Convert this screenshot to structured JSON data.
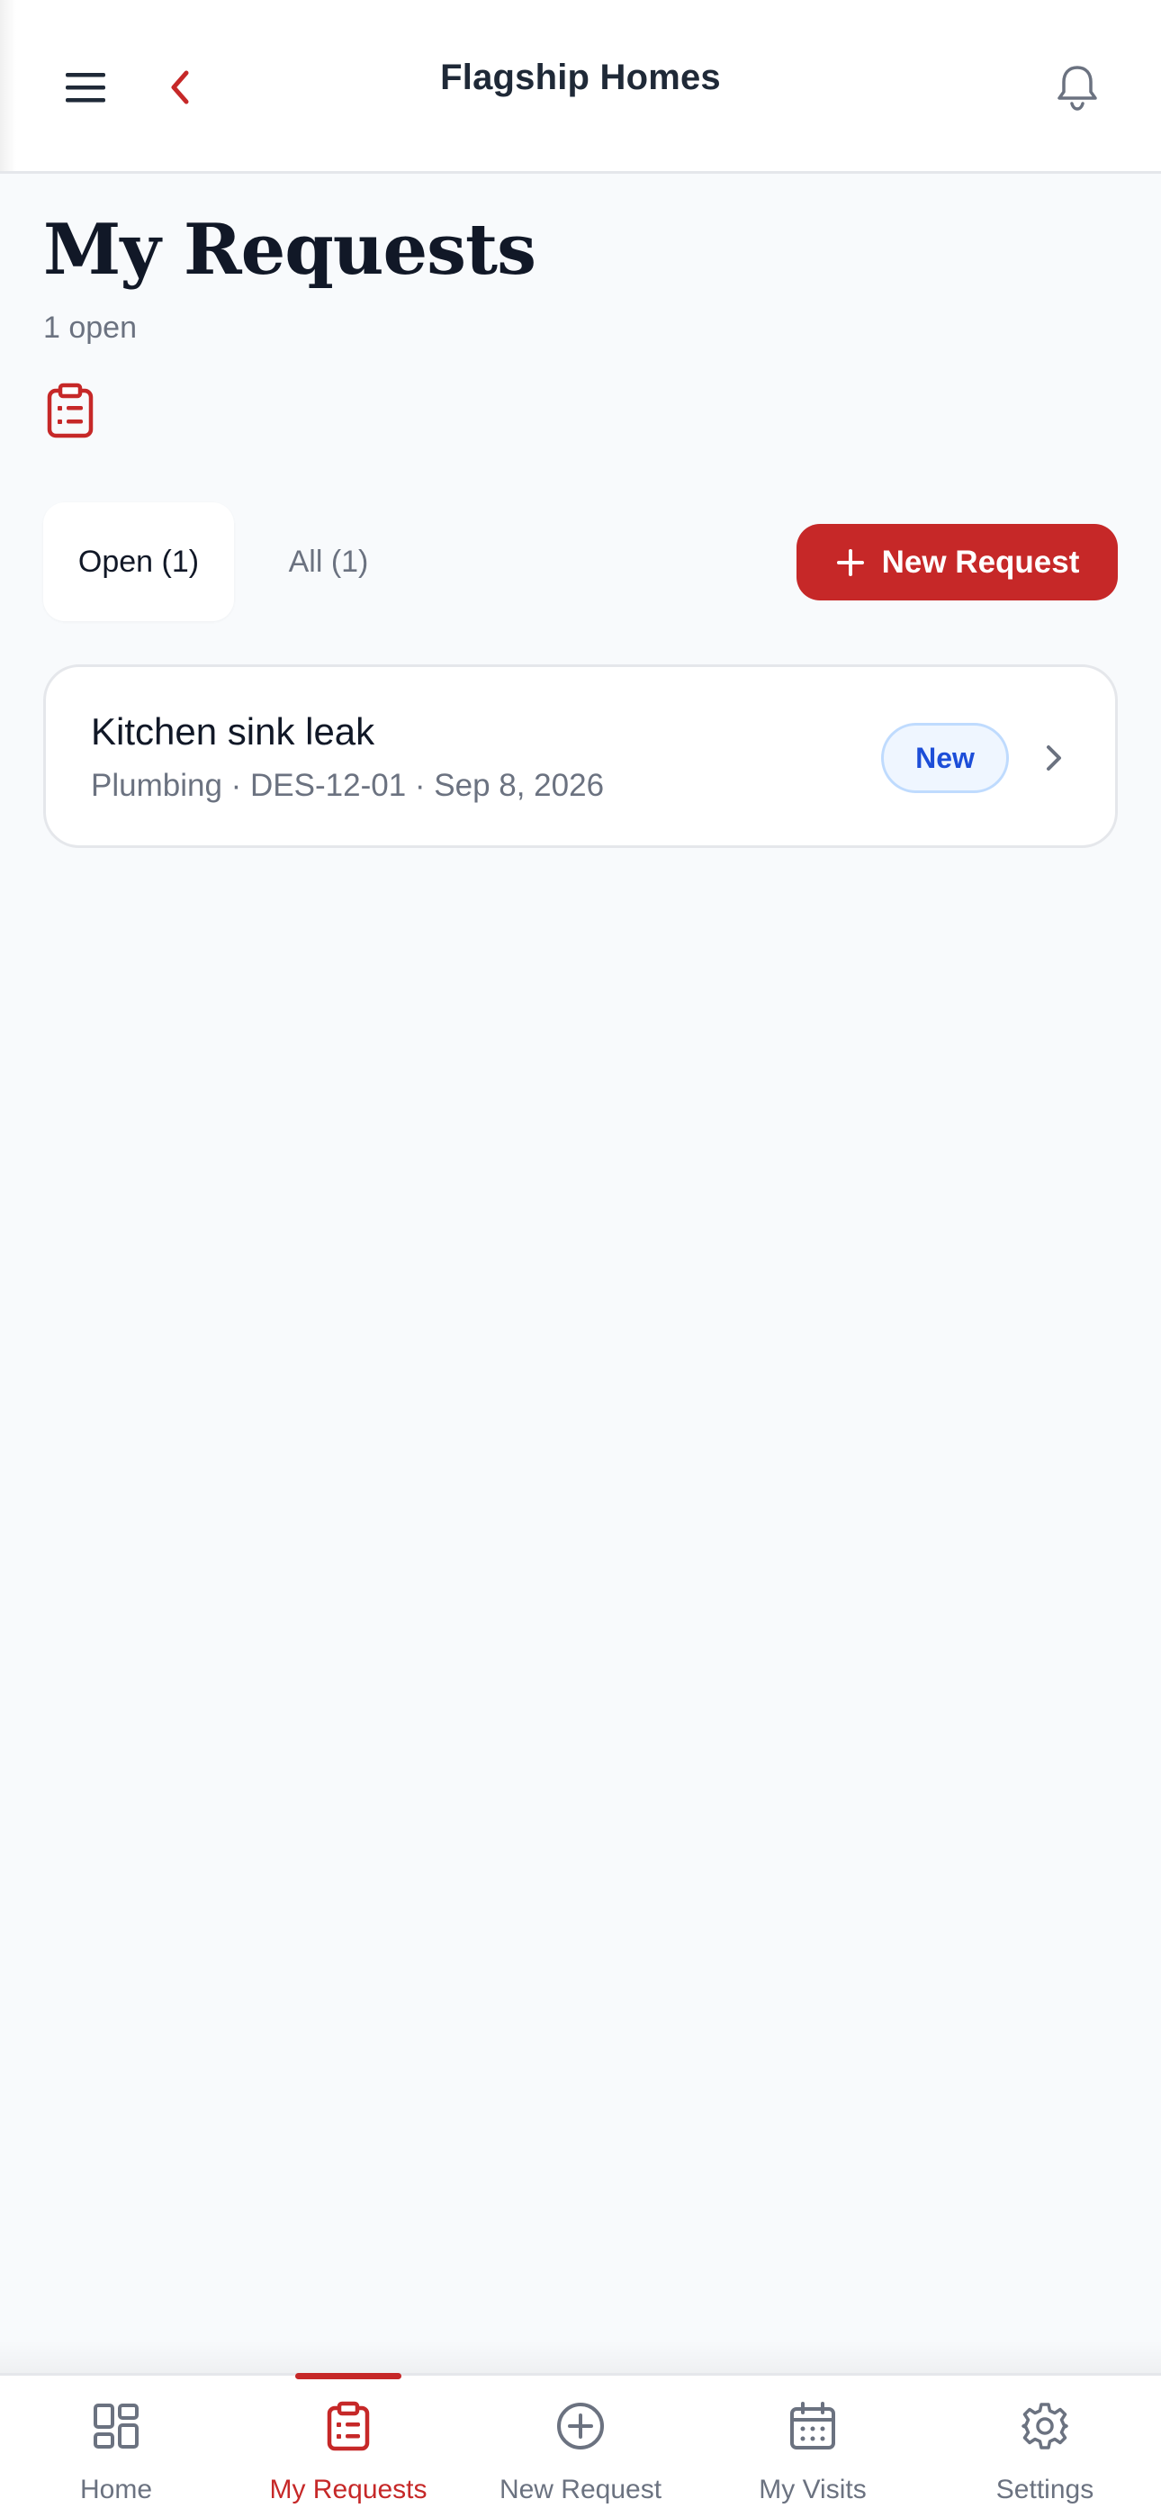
{
  "header": {
    "title": "Flagship Homes",
    "menu_icon": "hamburger-menu-icon",
    "back_icon": "chevron-left-icon",
    "notification_icon": "bell-icon"
  },
  "page": {
    "title": "My Requests",
    "subtitle": "1 open",
    "icon": "clipboard-list-icon"
  },
  "tabs": [
    {
      "label": "Open (1)",
      "selected": true
    },
    {
      "label": "All (1)",
      "selected": false
    }
  ],
  "actions": {
    "new_request_label": "New Request",
    "new_request_icon": "plus-icon"
  },
  "requests": [
    {
      "title": "Kitchen sink leak",
      "meta": "Plumbing · DES-12-01 · Sep 8, 2026",
      "status": "New"
    }
  ],
  "bottom_nav": [
    {
      "label": "Home",
      "icon": "grid-icon",
      "active": false
    },
    {
      "label": "My Requests",
      "icon": "clipboard-list-icon",
      "active": true
    },
    {
      "label": "New Request",
      "icon": "plus-circle-icon",
      "active": false
    },
    {
      "label": "My Visits",
      "icon": "calendar-icon",
      "active": false
    },
    {
      "label": "Settings",
      "icon": "gear-icon",
      "active": false
    }
  ],
  "colors": {
    "accent": "#c62828",
    "background": "#f8fafc",
    "status_new_text": "#1d4ed8",
    "status_new_bg": "#eff6ff",
    "muted_text": "#6b7280"
  }
}
